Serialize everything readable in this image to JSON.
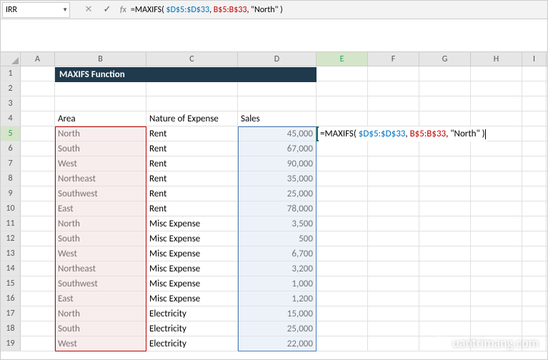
{
  "name_box": "IRR",
  "formula_text": "=MAXIFS( $D$5:$D$33, B$5:B$33, \"North\" )",
  "formula_parts": {
    "prefix": "=MAXIFS( ",
    "arg1": "$D$5:$D$33",
    "sep1": ", ",
    "arg2": "B$5:B$33",
    "sep2": ", \"North\" )"
  },
  "columns": [
    "A",
    "B",
    "C",
    "D",
    "E",
    "F",
    "G",
    "H",
    "I"
  ],
  "active_col": "E",
  "active_row": 5,
  "title": "MAXIFS Function",
  "headers": {
    "area": "Area",
    "nature": "Nature of Expense",
    "sales": "Sales"
  },
  "rows": [
    {
      "n": 5,
      "area": "North",
      "nature": "Rent",
      "sales": "45,000"
    },
    {
      "n": 6,
      "area": "South",
      "nature": "Rent",
      "sales": "67,000"
    },
    {
      "n": 7,
      "area": "West",
      "nature": "Rent",
      "sales": "90,000"
    },
    {
      "n": 8,
      "area": "Northeast",
      "nature": "Rent",
      "sales": "35,000"
    },
    {
      "n": 9,
      "area": "Southwest",
      "nature": "Rent",
      "sales": "25,000"
    },
    {
      "n": 10,
      "area": "East",
      "nature": "Rent",
      "sales": "78,000"
    },
    {
      "n": 11,
      "area": "North",
      "nature": "Misc Expense",
      "sales": "3,500"
    },
    {
      "n": 12,
      "area": "South",
      "nature": "Misc Expense",
      "sales": "500"
    },
    {
      "n": 13,
      "area": "West",
      "nature": "Misc Expense",
      "sales": "6,700"
    },
    {
      "n": 14,
      "area": "Northeast",
      "nature": "Misc Expense",
      "sales": "3,200"
    },
    {
      "n": 15,
      "area": "Southwest",
      "nature": "Misc Expense",
      "sales": "1,000"
    },
    {
      "n": 16,
      "area": "East",
      "nature": "Misc Expense",
      "sales": "1,200"
    },
    {
      "n": 17,
      "area": "North",
      "nature": "Electricity",
      "sales": "15,000"
    },
    {
      "n": 18,
      "area": "South",
      "nature": "Electricity",
      "sales": "25,000"
    },
    {
      "n": 19,
      "area": "West",
      "nature": "Electricity",
      "sales": "22,000"
    }
  ],
  "watermark": "uantrimang.com"
}
